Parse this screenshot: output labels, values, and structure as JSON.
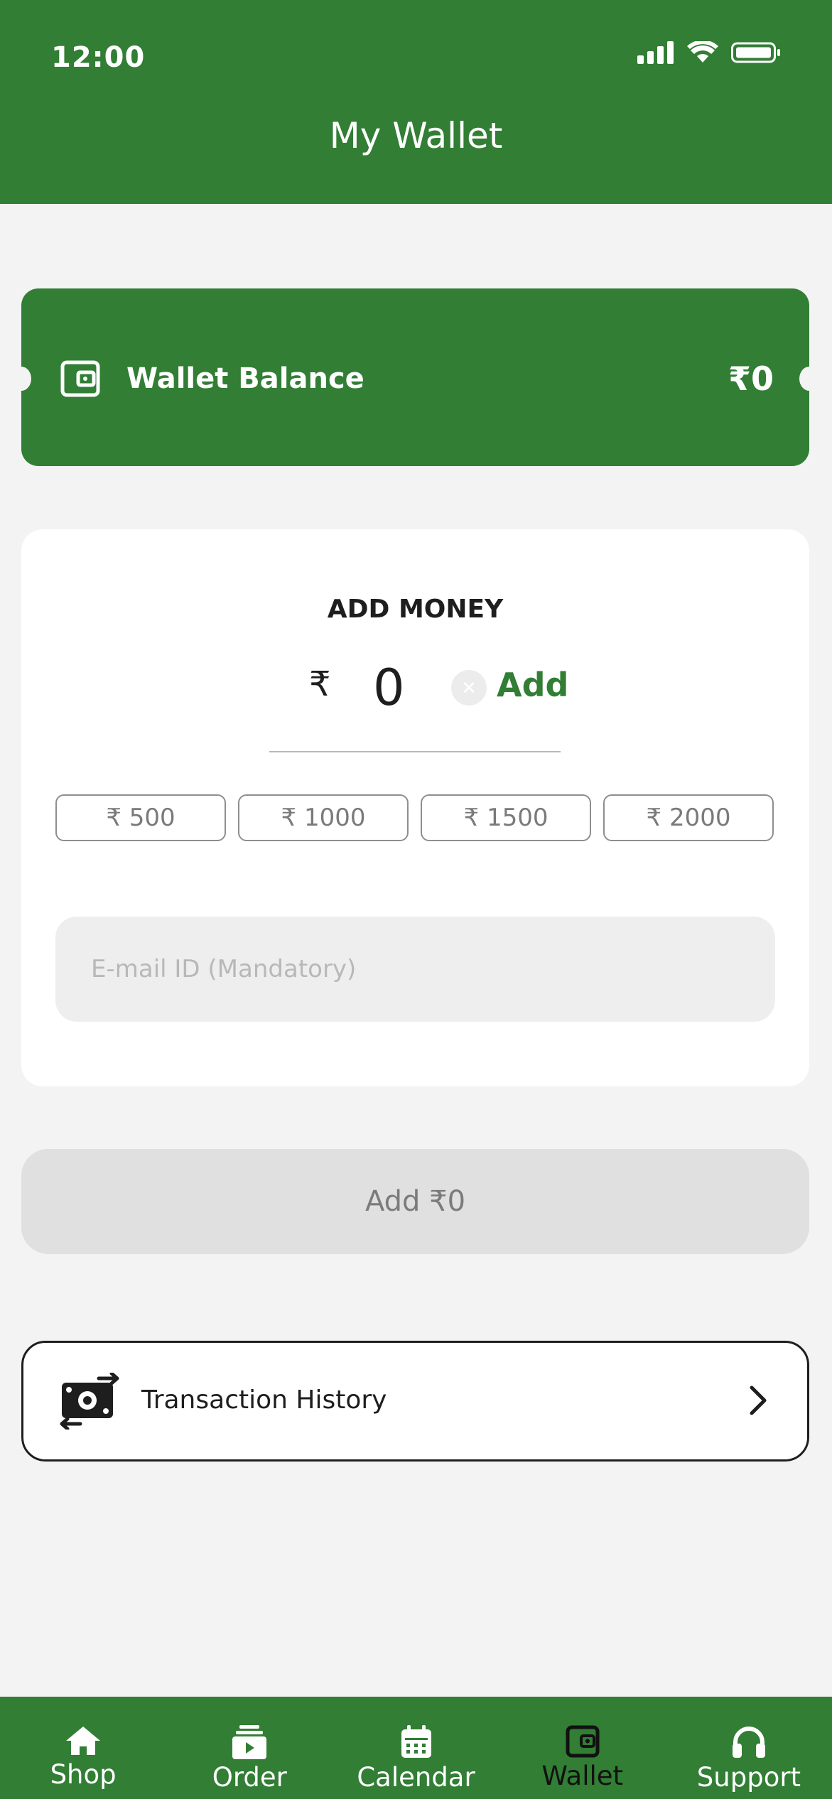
{
  "status_bar": {
    "time": "12:00",
    "icons": [
      "signal-icon",
      "wifi-icon",
      "battery-icon"
    ]
  },
  "header": {
    "title": "My Wallet"
  },
  "balance": {
    "label": "Wallet Balance",
    "value": "₹0",
    "icon": "wallet-icon"
  },
  "add_money": {
    "title": "ADD MONEY",
    "currency_symbol": "₹",
    "amount": "0",
    "add_link": "Add",
    "presets": [
      "₹ 500",
      "₹ 1000",
      "₹ 1500",
      "₹ 2000"
    ],
    "email_placeholder": "E-mail ID (Mandatory)",
    "email_value": ""
  },
  "submit": {
    "label": "Add ₹0"
  },
  "history": {
    "label": "Transaction History",
    "icon": "money-transfer-icon"
  },
  "tabs": [
    {
      "label": "Shop",
      "icon": "home-icon",
      "active": false
    },
    {
      "label": "Order",
      "icon": "order-icon",
      "active": false
    },
    {
      "label": "Calendar",
      "icon": "calendar-icon",
      "active": false
    },
    {
      "label": "Wallet",
      "icon": "wallet-icon",
      "active": true
    },
    {
      "label": "Support",
      "icon": "headphones-icon",
      "active": false
    }
  ],
  "colors": {
    "primary": "#317e34",
    "background": "#f3f3f4",
    "card": "#ffffff",
    "disabled": "#e0e0e0"
  }
}
